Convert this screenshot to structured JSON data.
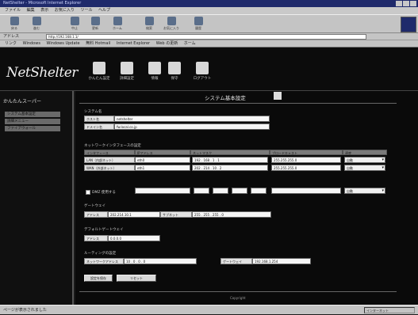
{
  "browser": {
    "title": "NetShelter - Microsoft Internet Explorer",
    "menu": [
      "ファイル",
      "編集",
      "表示",
      "お気に入り",
      "ツール",
      "ヘルプ"
    ],
    "toolbar": [
      "戻る",
      "進む",
      "中止",
      "更新",
      "ホーム",
      "検索",
      "お気に入り",
      "履歴"
    ],
    "address_label": "アドレス",
    "address_value": "http://192.168.1.1/",
    "links": [
      "リンク",
      "Windows",
      "Windows Update",
      "無料 Hotmail",
      "Internet Explorer",
      "Web の更新",
      "ホーム"
    ],
    "status_left": "ページが表示されました",
    "status_zone": "インターネット"
  },
  "app": {
    "brand": "NetShelter",
    "header_buttons": [
      "かんたん設定",
      "詳細設定",
      "情報",
      "保守",
      "ログアウト"
    ]
  },
  "sidebar": {
    "title": "かんたんスーパー",
    "items": [
      "システム基本設定",
      "詳細メニュー",
      "ファイアウォール"
    ]
  },
  "main": {
    "page_title": "システム基本設定",
    "system": {
      "section": "システム名",
      "host_label": "ホスト名",
      "host_value": "netshelter",
      "domain_label": "ドメイン名",
      "domain_value": "fw.local.co.jp"
    },
    "lan": {
      "section": "ネットワークインタフェースの設定",
      "headers": [
        "インタフェース",
        "IPアドレス",
        "ネットマスク",
        "ブロードキャスト",
        "速度"
      ],
      "rows": [
        {
          "label": "LAN（内部ネット）",
          "name": "eth0",
          "ip": "192 . 168 . 1 . 1",
          "mask": "255.255.255.0",
          "speed": "自動"
        },
        {
          "label": "WAN（外部ネット）",
          "name": "eth1",
          "ip": "202 . 214 . 10 . 2",
          "mask": "255.255.255.0",
          "speed": "自動"
        }
      ],
      "dmz_label": "DMZ 使用する",
      "dmz_speed": "自動"
    },
    "gateway": {
      "section": "ゲートウェイ",
      "label": "アドレス",
      "value": "202.214.10.1",
      "sub_label": "サブネット",
      "sub_value": "255 . 255 . 255 . 0"
    },
    "dns": {
      "section": "デフォルトゲートウェイ",
      "label": "アドレス",
      "value": "0.0.0.0"
    },
    "routing": {
      "section": "ルーティングの設定",
      "net_label": "ネットワークアドレス",
      "net_value": "10 . 0 . 0 . 0",
      "gw_label": "ゲートウェイ",
      "gw_value": "192.168.1.254"
    },
    "buttons": [
      "設定を保存",
      "リセット"
    ],
    "footer": "Copyright"
  }
}
